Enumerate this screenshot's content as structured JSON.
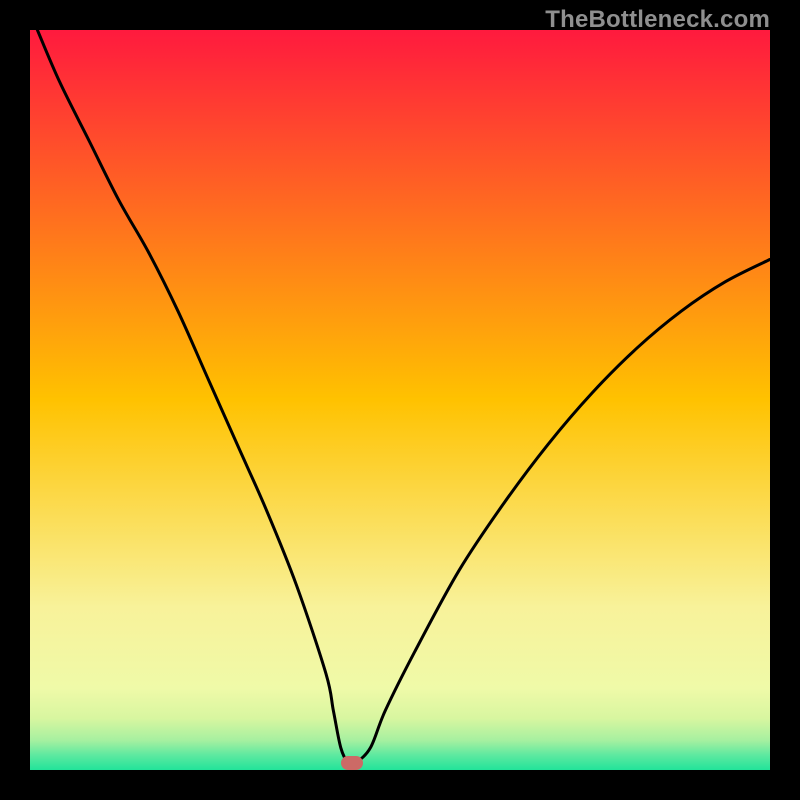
{
  "watermark": {
    "text": "TheBottleneck.com"
  },
  "chart_data": {
    "type": "line",
    "title": "",
    "xlabel": "",
    "ylabel": "",
    "xlim": [
      0,
      100
    ],
    "ylim": [
      0,
      100
    ],
    "background_gradient": {
      "stops_from_top": [
        {
          "pct": 0,
          "color": "#ff1a3e"
        },
        {
          "pct": 50,
          "color": "#ffc200"
        },
        {
          "pct": 78,
          "color": "#f8f29a"
        },
        {
          "pct": 89,
          "color": "#effaa8"
        },
        {
          "pct": 93,
          "color": "#d8f6a0"
        },
        {
          "pct": 96,
          "color": "#a6f0a0"
        },
        {
          "pct": 98,
          "color": "#5de9a0"
        },
        {
          "pct": 100,
          "color": "#22e39a"
        }
      ]
    },
    "series": [
      {
        "name": "bottleneck-curve",
        "x": [
          1,
          4,
          8,
          12,
          16,
          20,
          24,
          28,
          32,
          36,
          40,
          41,
          42,
          43,
          44,
          46,
          48,
          52,
          58,
          64,
          70,
          76,
          82,
          88,
          94,
          100
        ],
        "y": [
          100,
          93,
          85,
          77,
          70,
          62,
          53,
          44,
          35,
          25,
          13,
          8,
          3,
          1,
          1,
          3,
          8,
          16,
          27,
          36,
          44,
          51,
          57,
          62,
          66,
          69
        ],
        "flat_bottom": {
          "x_start": 42.5,
          "x_end": 45,
          "y": 1
        }
      }
    ],
    "marker": {
      "name": "optimum",
      "x": 43.5,
      "y": 1,
      "color": "#cc6a66",
      "shape": "pill"
    }
  }
}
